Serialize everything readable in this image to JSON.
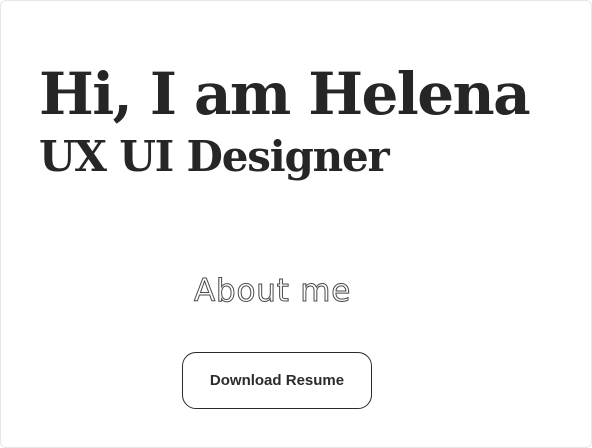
{
  "hero": {
    "headline": "Hi, I am Helena",
    "role": "UX UI Designer"
  },
  "about": {
    "label": "About me"
  },
  "actions": {
    "download_resume_label": "Download Resume"
  },
  "colors": {
    "text": "#262626",
    "background": "#ffffff",
    "button_border": "#2b2b2b",
    "outline_text": "#4a4a4a"
  }
}
